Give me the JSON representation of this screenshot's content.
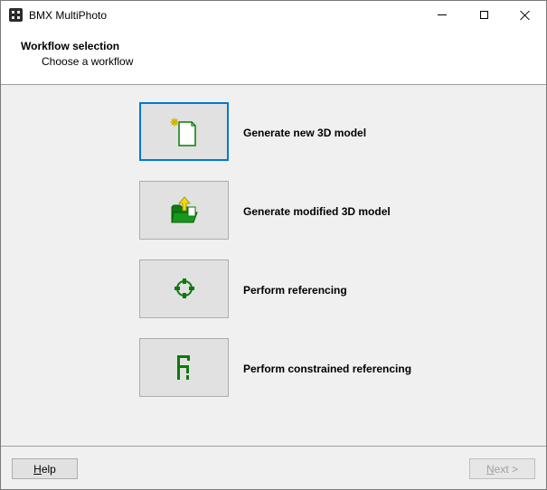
{
  "window": {
    "title": "BMX MultiPhoto"
  },
  "header": {
    "title": "Workflow selection",
    "subtitle": "Choose a workflow"
  },
  "options": [
    {
      "label": "Generate new 3D model",
      "icon": "new-document-icon",
      "selected": true
    },
    {
      "label": "Generate modified 3D model",
      "icon": "open-folder-icon",
      "selected": false
    },
    {
      "label": "Perform referencing",
      "icon": "crosshair-target-icon",
      "selected": false
    },
    {
      "label": "Perform constrained referencing",
      "icon": "constrained-reference-icon",
      "selected": false
    }
  ],
  "footer": {
    "help_label": "Help",
    "next_label": "Next >"
  },
  "colors": {
    "accent": "#0078d7",
    "icon_green": "#0a7a0a"
  }
}
